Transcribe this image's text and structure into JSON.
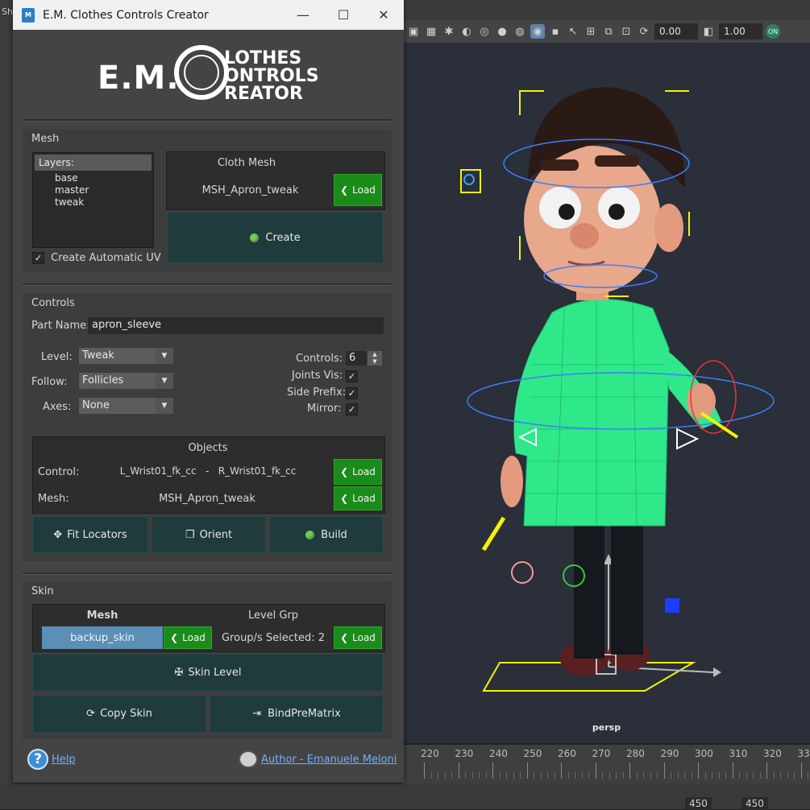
{
  "window": {
    "title": "E.M. Clothes Controls Creator",
    "app_icon": "M"
  },
  "logo": {
    "prefix": "E.M.",
    "line1": "LOTHES",
    "line2": "ONTROLS",
    "line3": "REATOR",
    "letter": "C"
  },
  "mesh": {
    "section_title": "Mesh",
    "layers_header": "Layers:",
    "layers": [
      "base",
      "master",
      "tweak"
    ],
    "create_uv_label": "Create Automatic UV",
    "create_uv_checked": true,
    "cloth_mesh_title": "Cloth Mesh",
    "cloth_mesh_value": "MSH_Apron_tweak",
    "load_label": "Load",
    "create_label": "Create"
  },
  "controls": {
    "section_title": "Controls",
    "part_name_label": "Part Name:",
    "part_name_value": "apron_sleeve",
    "level_label": "Level:",
    "level_value": "Tweak",
    "follow_label": "Follow:",
    "follow_value": "Follicles",
    "axes_label": "Axes:",
    "axes_value": "None",
    "controls_label": "Controls:",
    "controls_value": "6",
    "joints_vis_label": "Joints Vis:",
    "side_prefix_label": "Side Prefix:",
    "mirror_label": "Mirror:",
    "objects_title": "Objects",
    "control_label": "Control:",
    "control_value": "L_Wrist01_fk_cc   -   R_Wrist01_fk_cc",
    "mesh_label": "Mesh:",
    "mesh_value": "MSH_Apron_tweak",
    "load_label": "Load",
    "fit_locators_label": "Fit Locators",
    "orient_label": "Orient",
    "build_label": "Build"
  },
  "skin": {
    "section_title": "Skin",
    "mesh_header": "Mesh",
    "level_grp_header": "Level Grp",
    "mesh_value": "backup_skin",
    "level_grp_value": "Group/s Selected: 2",
    "load_label": "Load",
    "skin_level_label": "Skin Level",
    "copy_skin_label": "Copy Skin",
    "bind_pre_matrix_label": "BindPreMatrix"
  },
  "footer": {
    "help_label": "Help",
    "author_label": "Author - Emanuele Meloni"
  },
  "maya": {
    "toolbar_value1": "0.00",
    "toolbar_value2": "1.00",
    "toolbar_on": "ON",
    "viewport_label": "persp",
    "timeline_ticks": [
      "220",
      "230",
      "240",
      "250",
      "260",
      "270",
      "280",
      "290",
      "300",
      "310",
      "320",
      "33"
    ],
    "range_end1": "450",
    "range_end2": "450",
    "left_strip_text": "Sh"
  },
  "colors": {
    "accent_green": "#1a8c1a",
    "button_teal": "#1f3b3b",
    "mesh_blue": "#5b8fb5",
    "apron_green": "#2ee88a"
  }
}
